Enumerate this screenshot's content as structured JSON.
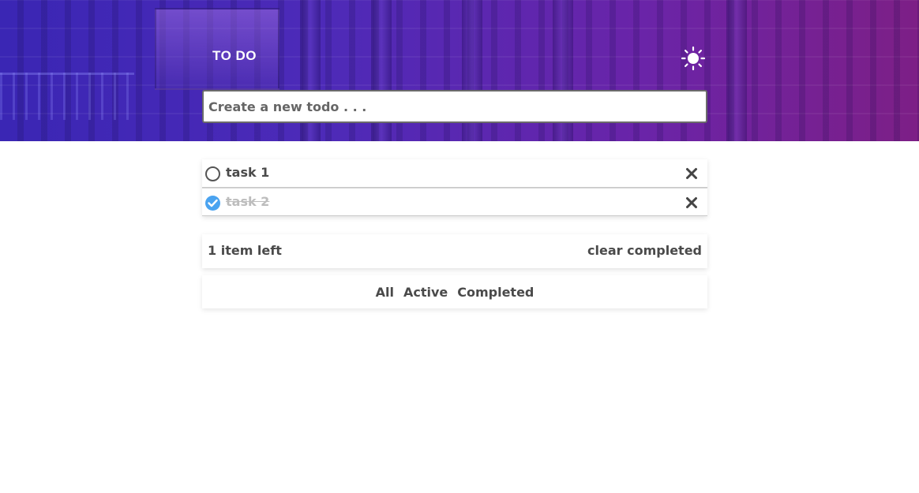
{
  "header": {
    "title": "TO DO",
    "theme_icon": "sun-icon"
  },
  "new_todo": {
    "placeholder": "Create a new todo . . .",
    "value": ""
  },
  "todos": [
    {
      "text": "task 1",
      "completed": false
    },
    {
      "text": "task 2",
      "completed": true
    }
  ],
  "footer": {
    "items_left": "1 item left",
    "clear_completed": "clear completed"
  },
  "filters": {
    "all": "All",
    "active": "Active",
    "completed": "Completed"
  },
  "colors": {
    "accent": "#4aa3f0",
    "text": "#4a4a4a",
    "completed_text": "#bdbdbd",
    "hero_start": "#3a26b4",
    "hero_end": "#7d1f86"
  }
}
